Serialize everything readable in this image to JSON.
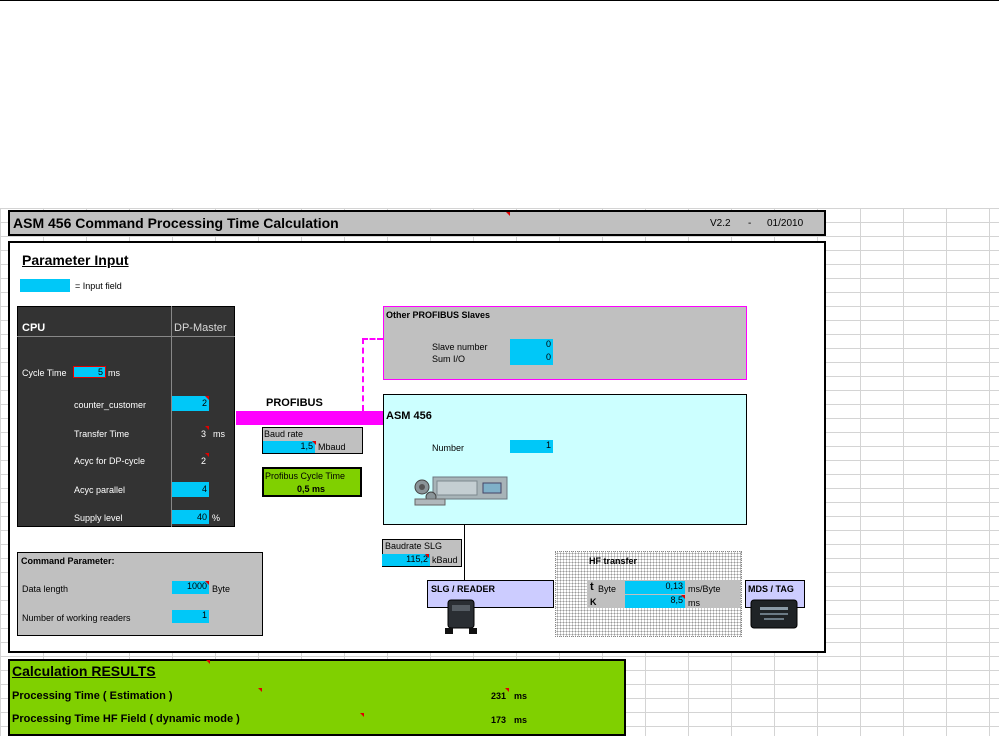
{
  "header": {
    "title": "ASM 456 Command Processing Time Calculation",
    "version": "V2.2",
    "dash": "-",
    "date": "01/2010"
  },
  "parameter_input": {
    "heading": "Parameter Input",
    "legend_text": "= Input field"
  },
  "cpu_panel": {
    "cpu_title": "CPU",
    "dp_title": "DP-Master",
    "cycle_time_label": "Cycle Time",
    "cycle_time_value": "5",
    "cycle_time_unit": "ms",
    "counter_customer_label": "counter_customer",
    "counter_customer_value": "2",
    "transfer_time_label": "Transfer Time",
    "transfer_time_value": "3",
    "transfer_time_unit": "ms",
    "acyc_dp_label": "Acyc for DP-cycle",
    "acyc_dp_value": "2",
    "acyc_parallel_label": "Acyc parallel",
    "acyc_parallel_value": "4",
    "supply_level_label": "Supply level",
    "supply_level_value": "40",
    "supply_level_unit": "%"
  },
  "profibus": {
    "label": "PROFIBUS",
    "baud_rate_label": "Baud rate",
    "baud_rate_value": "1,5",
    "baud_rate_unit": "Mbaud",
    "cycle_time_label": "Profibus Cycle Time",
    "cycle_time_value": "0,5 ms"
  },
  "other_slaves": {
    "title": "Other PROFIBUS Slaves",
    "slave_number_label": "Slave number",
    "slave_number_value": "0",
    "sum_io_label": "Sum I/O",
    "sum_io_value": "0"
  },
  "asm": {
    "title": "ASM 456",
    "number_label": "Number",
    "number_value": "1"
  },
  "command_parameter": {
    "title": "Command Parameter:",
    "data_length_label": "Data length",
    "data_length_value": "1000",
    "data_length_unit": "Byte",
    "readers_label": "Number of working readers",
    "readers_value": "1"
  },
  "baudrate_slg": {
    "label": "Baudrate SLG",
    "value": "115,2",
    "unit": "kBaud"
  },
  "slg": {
    "label": "SLG / READER"
  },
  "hf_transfer": {
    "title": "HF transfer",
    "t_label": "t",
    "byte_label": "Byte",
    "t_value": "0,13",
    "t_unit": "ms/Byte",
    "k_label": "K",
    "k_value": "8,5",
    "k_unit": "ms"
  },
  "mds": {
    "label": "MDS / TAG"
  },
  "results": {
    "title": "Calculation RESULTS",
    "processing_time_label": "Processing Time   ( Estimation )",
    "processing_time_value": "231",
    "processing_time_unit": "ms",
    "hf_time_label": "Processing Time HF Field  ( dynamic mode )",
    "hf_time_value": "173",
    "hf_time_unit": "ms"
  },
  "colors": {
    "input_field": "#00c8f8",
    "profibus": "#ff00ff",
    "results_bg": "#80d000",
    "asm_bg": "#ccffff"
  }
}
